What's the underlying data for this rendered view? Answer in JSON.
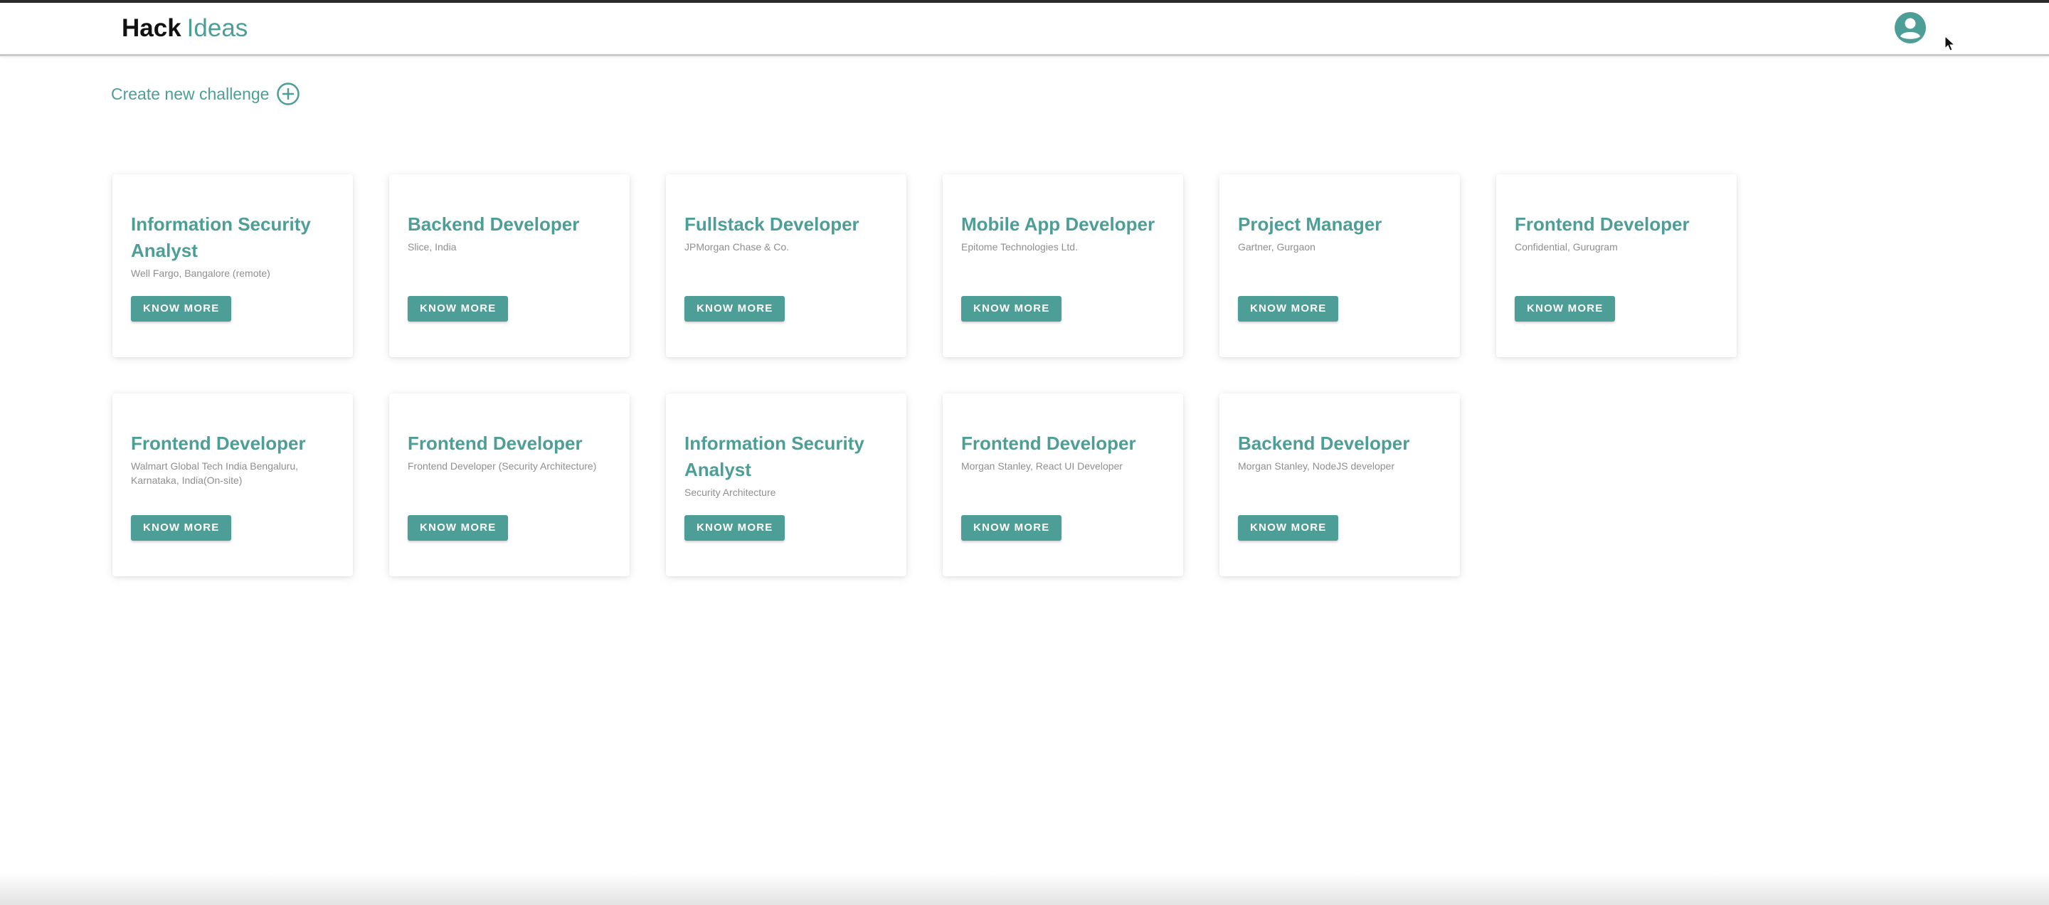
{
  "app": {
    "logo_primary": "Hack",
    "logo_secondary": "Ideas",
    "brand_color": "#4d9e96",
    "header_icon": "user-account-icon"
  },
  "toolbar": {
    "create_label": "Create new challenge",
    "create_icon": "plus-circle-icon"
  },
  "challenges": [
    {
      "title": "Information Security Analyst",
      "subtitle": "Well Fargo, Bangalore (remote)",
      "button": "KNOW MORE"
    },
    {
      "title": "Backend Developer",
      "subtitle": "Slice, India",
      "button": "KNOW MORE"
    },
    {
      "title": "Fullstack Developer",
      "subtitle": "JPMorgan Chase & Co.",
      "button": "KNOW MORE"
    },
    {
      "title": "Mobile App Developer",
      "subtitle": "Epitome Technologies Ltd.",
      "button": "KNOW MORE"
    },
    {
      "title": "Project Manager",
      "subtitle": "Gartner, Gurgaon",
      "button": "KNOW MORE"
    },
    {
      "title": "Frontend Developer",
      "subtitle": "Confidential, Gurugram",
      "button": "KNOW MORE"
    },
    {
      "title": "Frontend Developer",
      "subtitle": "Walmart Global Tech India Bengaluru, Karnataka, India(On-site)",
      "button": "KNOW MORE"
    },
    {
      "title": "Frontend Developer",
      "subtitle": "Frontend Developer (Security Architecture)",
      "button": "KNOW MORE"
    },
    {
      "title": "Information Security Analyst",
      "subtitle": "Security Architecture",
      "button": "KNOW MORE"
    },
    {
      "title": "Frontend Developer",
      "subtitle": "Morgan Stanley, React UI Developer",
      "button": "KNOW MORE"
    },
    {
      "title": "Backend Developer",
      "subtitle": "Morgan Stanley, NodeJS developer",
      "button": "KNOW MORE"
    }
  ]
}
